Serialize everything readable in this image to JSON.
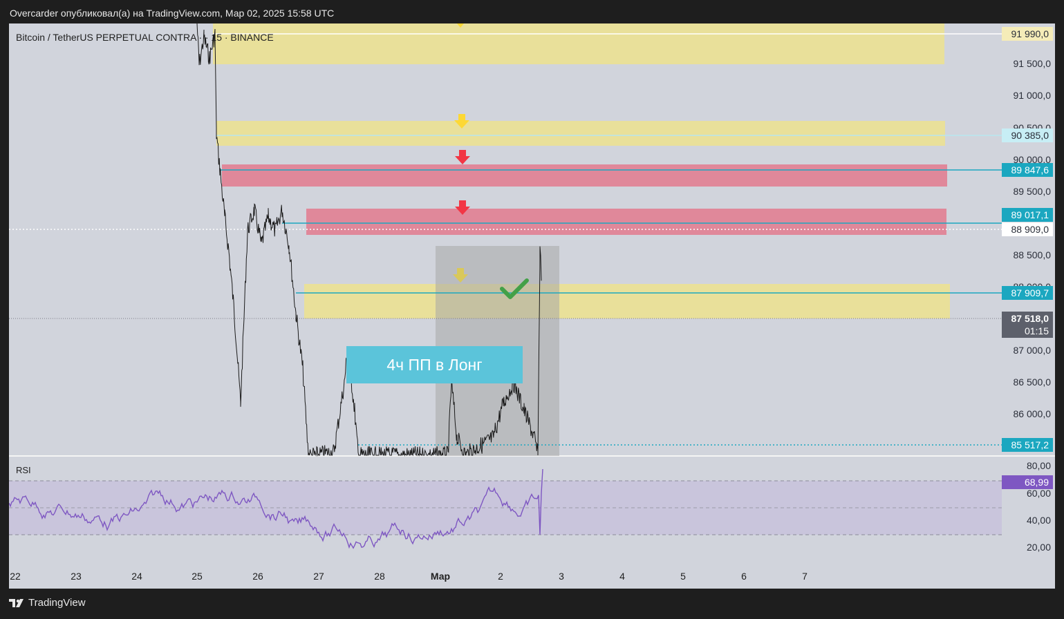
{
  "caption": "Overcarder опубликовал(а) на TradingView.com, Мар 02, 2025 15:58 UTC",
  "symbol_title": "Bitcoin / TetherUS PERPETUAL CONTRA ··· 15 · BINANCE",
  "annotation_text": "4ч ПП в Лонг",
  "rsi_label": "RSI",
  "brand": "TradingView",
  "price_axis": [
    "91 500,0",
    "91 000,0",
    "90 500,0",
    "90 000,0",
    "89 500,0",
    "88 500,0",
    "88 000,0",
    "87 000,0",
    "86 500,0",
    "86 000,0"
  ],
  "badges": {
    "b91990": "91 990,0",
    "b90385": "90 385,0",
    "b89847": "89 847,6",
    "b89017": "89 017,1",
    "b88909": "88 909,0",
    "b87909": "87 909,7",
    "b87518": "87 518,0",
    "b_timer": "01:15",
    "b85517": "85 517,2"
  },
  "rsi_axis": [
    "80,00",
    "60,00",
    "40,00",
    "20,00"
  ],
  "rsi_value": "68,99",
  "date_axis": [
    "22",
    "23",
    "24",
    "25",
    "26",
    "27",
    "28",
    "Мар",
    "2",
    "3",
    "4",
    "5",
    "6",
    "7"
  ],
  "colors": {
    "zone_yellow": "#e9e09a",
    "zone_red": "#e0889a",
    "teal_line": "#1ba7c0",
    "rsi_purple": "#7e57c2",
    "arrow_yellow": "#fdd835",
    "arrow_red": "#f23645",
    "check_green": "#43a047"
  }
}
